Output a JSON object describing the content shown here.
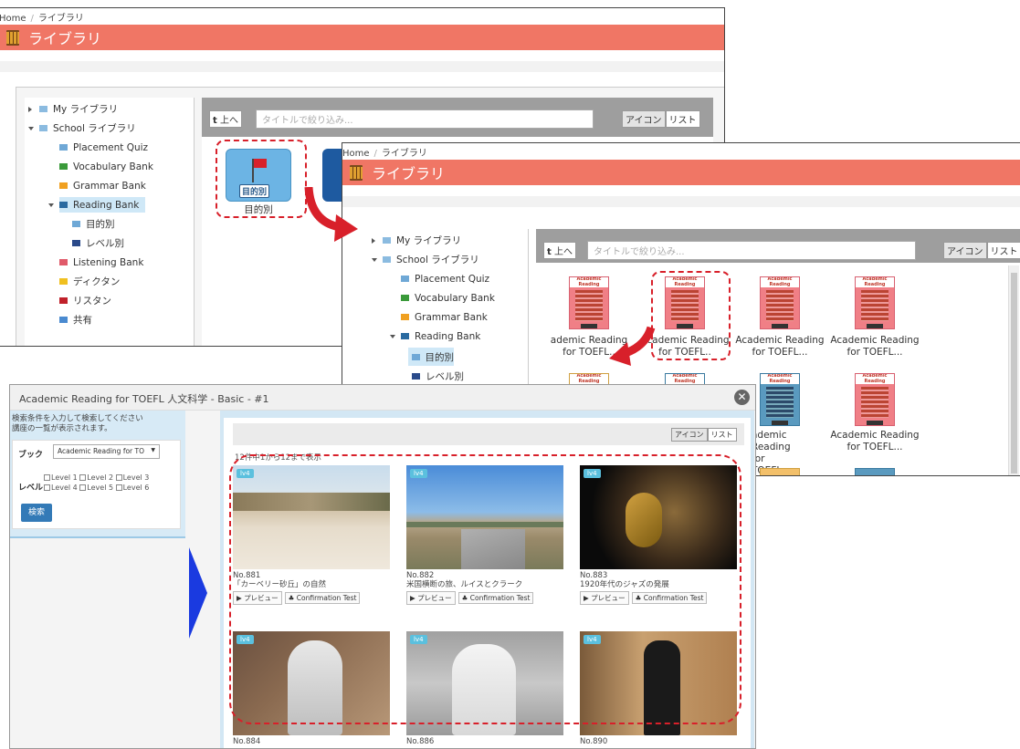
{
  "breadcrumb": {
    "home": "Home",
    "sep": "/",
    "current": "ライブラリ"
  },
  "header": {
    "title": "ライブラリ"
  },
  "tree": {
    "my": "My ライブラリ",
    "school": "School ライブラリ",
    "placement": "Placement Quiz",
    "vocabulary": "Vocabulary Bank",
    "grammar": "Grammar Bank",
    "reading": "Reading Bank",
    "mokuteki": "目的別",
    "level": "レベル別",
    "listening": "Listening Bank",
    "dictation": "ディクタン",
    "ristan": "リスタン",
    "kyoyu": "共有"
  },
  "toolbar": {
    "up_label": "上へ",
    "up_icon": "t",
    "filter_placeholder": "タイトルで絞り込み...",
    "icon_view": "アイコン",
    "list_view": "リスト"
  },
  "folder": {
    "label": "目的別",
    "icon_text": "目的別",
    "icon_name": "flag-folder-icon"
  },
  "books": {
    "cover_title": "Academic Reading",
    "cover_sub": "TOEFL",
    "cover_basic": "Basic",
    "line1": "Academic Reading",
    "line2": "for TOEFL...",
    "line1_cut": "cademic Re",
    "line2_cut": "for TOEFL..",
    "line1_cut2": "ademic Reading",
    "line2_cut2": "for TOEFL..."
  },
  "modal": {
    "title": "Academic Reading for TOEFL 人文科学 - Basic - #1",
    "hint1": "検索条件を入力して検索してください",
    "hint2": "講座の一覧が表示されます。",
    "book_label": "ブック",
    "book_value": "Academic Reading for TO",
    "level_label": "レベル",
    "levels": [
      "Level 1",
      "Level 2",
      "Level 3",
      "Level 4",
      "Level 5",
      "Level 6"
    ],
    "search": "検索",
    "count": "12件中1から12まで表示",
    "preview": "▶ プレビュー",
    "confirm": "Confirmation Test",
    "items": [
      {
        "lv": "lv4",
        "no": "No.881",
        "title": "「カーベリー砂丘」の自然"
      },
      {
        "lv": "lv4",
        "no": "No.882",
        "title": "米国横断の旅、ルイスとクラーク"
      },
      {
        "lv": "lv4",
        "no": "No.883",
        "title": "1920年代のジャズの発展"
      },
      {
        "lv": "lv4",
        "no": "No.884",
        "title": ""
      },
      {
        "lv": "lv4",
        "no": "No.886",
        "title": ""
      },
      {
        "lv": "lv4",
        "no": "No.890",
        "title": ""
      }
    ]
  },
  "colors": {
    "header": "#f07665",
    "accent": "#d8202a",
    "selected": "#cfe8f7",
    "search_btn": "#337ab7"
  }
}
